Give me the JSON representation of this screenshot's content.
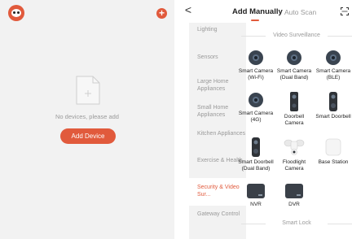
{
  "left": {
    "empty_text": "No devices, please add",
    "add_device_label": "Add Device",
    "plus_symbol": "+"
  },
  "right": {
    "back_symbol": "<",
    "tabs": [
      {
        "label": "Add Manually",
        "active": true
      },
      {
        "label": "Auto Scan",
        "active": false
      }
    ],
    "categories": [
      {
        "label": "Lighting"
      },
      {
        "label": "Sensors"
      },
      {
        "label": "Large Home Appliances"
      },
      {
        "label": "Small Home Appliances"
      },
      {
        "label": "Kitchen Appliances"
      },
      {
        "label": "Exercise & Health"
      },
      {
        "label": "Security & Video Sur...",
        "active": true
      },
      {
        "label": "Gateway Control"
      }
    ],
    "sections": [
      {
        "title": "Video Surveillance"
      },
      {
        "title": "Smart Lock"
      }
    ],
    "devices": [
      {
        "label": "Smart Camera (Wi-Fi)",
        "icon": "camera-icon"
      },
      {
        "label": "Smart Camera (Dual Band)",
        "icon": "camera-icon"
      },
      {
        "label": "Smart Camera (BLE)",
        "icon": "camera-icon"
      },
      {
        "label": "Smart Camera (4G)",
        "icon": "camera-icon"
      },
      {
        "label": "Doorbell Camera",
        "icon": "doorbell-icon"
      },
      {
        "label": "Smart Doorbell",
        "icon": "doorbell-icon"
      },
      {
        "label": "Smart Doorbell (Dual Band)",
        "icon": "doorbell-icon"
      },
      {
        "label": "Floodlight Camera",
        "icon": "floodlight-camera-icon"
      },
      {
        "label": "Base Station",
        "icon": "base-station-icon"
      },
      {
        "label": "NVR",
        "icon": "nvr-icon"
      },
      {
        "label": "DVR",
        "icon": "dvr-icon"
      }
    ]
  },
  "colors": {
    "accent": "#e15a3c",
    "sidebar_bg": "#f2f2f2",
    "muted_text": "#999999"
  }
}
